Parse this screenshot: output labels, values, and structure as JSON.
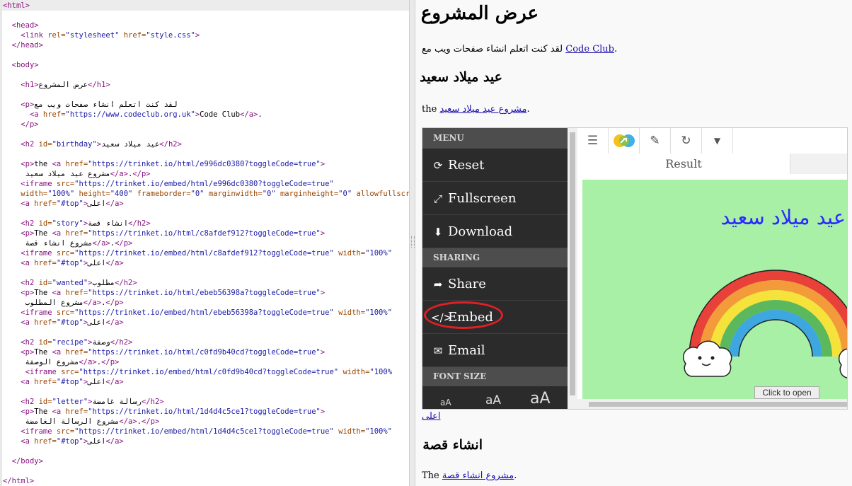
{
  "editor": {
    "lines": [
      {
        "t": [
          [
            "tag",
            "<html>"
          ]
        ]
      },
      {
        "t": []
      },
      {
        "t": [
          [
            "text",
            "  "
          ],
          [
            "tag",
            "<head>"
          ]
        ]
      },
      {
        "t": [
          [
            "text",
            "    "
          ],
          [
            "tag",
            "<link "
          ],
          [
            "attr",
            "rel="
          ],
          [
            "val",
            "\"stylesheet\""
          ],
          [
            "attr",
            " href="
          ],
          [
            "val",
            "\"style.css\""
          ],
          [
            "tag",
            ">"
          ]
        ]
      },
      {
        "t": [
          [
            "text",
            "  "
          ],
          [
            "tag",
            "</head>"
          ]
        ]
      },
      {
        "t": []
      },
      {
        "t": [
          [
            "text",
            "  "
          ],
          [
            "tag",
            "<body>"
          ]
        ]
      },
      {
        "t": []
      },
      {
        "t": [
          [
            "text",
            "    "
          ],
          [
            "tag",
            "<h1>"
          ],
          [
            "text",
            "عرض المشروع"
          ],
          [
            "tag",
            "</h1>"
          ]
        ]
      },
      {
        "t": []
      },
      {
        "t": [
          [
            "text",
            "    "
          ],
          [
            "tag",
            "<p>"
          ],
          [
            "text",
            "لقد كنت اتعلم انشاء صفحات ويب مع"
          ]
        ]
      },
      {
        "t": [
          [
            "text",
            "      "
          ],
          [
            "tag",
            "<a "
          ],
          [
            "attr",
            "href="
          ],
          [
            "val",
            "\"https://www.codeclub.org.uk\""
          ],
          [
            "tag",
            ">"
          ],
          [
            "text",
            "Code Club"
          ],
          [
            "tag",
            "</a>"
          ],
          [
            "text",
            "."
          ]
        ]
      },
      {
        "t": [
          [
            "text",
            "    "
          ],
          [
            "tag",
            "</p>"
          ]
        ]
      },
      {
        "t": []
      },
      {
        "t": [
          [
            "text",
            "    "
          ],
          [
            "tag",
            "<h2 "
          ],
          [
            "attr",
            "id="
          ],
          [
            "val",
            "\"birthday\""
          ],
          [
            "tag",
            ">"
          ],
          [
            "text",
            "عيد ميلاد سعيد"
          ],
          [
            "tag",
            "</h2>"
          ]
        ]
      },
      {
        "t": []
      },
      {
        "t": [
          [
            "text",
            "    "
          ],
          [
            "tag",
            "<p>"
          ],
          [
            "text",
            "the "
          ],
          [
            "tag",
            "<a "
          ],
          [
            "attr",
            "href="
          ],
          [
            "val",
            "\"https://trinket.io/html/e996dc0380?toggleCode=true\""
          ],
          [
            "tag",
            ">"
          ]
        ]
      },
      {
        "t": [
          [
            "text",
            "     مشروع عيد ميلاد سعيد"
          ],
          [
            "tag",
            "</a>"
          ],
          [
            "text",
            "."
          ],
          [
            "tag",
            "</p>"
          ]
        ]
      },
      {
        "t": [
          [
            "text",
            "    "
          ],
          [
            "tag",
            "<iframe "
          ],
          [
            "attr",
            "src="
          ],
          [
            "val",
            "\"https://trinket.io/embed/html/e996dc0380?toggleCode=true\""
          ]
        ]
      },
      {
        "t": [
          [
            "attr",
            "    width="
          ],
          [
            "val",
            "\"100%\""
          ],
          [
            "attr",
            " height="
          ],
          [
            "val",
            "\"400\""
          ],
          [
            "attr",
            " frameborder="
          ],
          [
            "val",
            "\"0\""
          ],
          [
            "attr",
            " marginwidth="
          ],
          [
            "val",
            "\"0\""
          ],
          [
            "attr",
            " marginheight="
          ],
          [
            "val",
            "\"0\""
          ],
          [
            "attr",
            " allowfullscreen"
          ]
        ]
      },
      {
        "t": [
          [
            "text",
            "    "
          ],
          [
            "tag",
            "<a "
          ],
          [
            "attr",
            "href="
          ],
          [
            "val",
            "\"#top\""
          ],
          [
            "tag",
            ">"
          ],
          [
            "text",
            "اعلى"
          ],
          [
            "tag",
            "</a>"
          ]
        ]
      },
      {
        "t": []
      },
      {
        "t": [
          [
            "text",
            "    "
          ],
          [
            "tag",
            "<h2 "
          ],
          [
            "attr",
            "id="
          ],
          [
            "val",
            "\"story\""
          ],
          [
            "tag",
            ">"
          ],
          [
            "text",
            "انشاء قصة"
          ],
          [
            "tag",
            "</h2>"
          ]
        ]
      },
      {
        "t": [
          [
            "text",
            "    "
          ],
          [
            "tag",
            "<p>"
          ],
          [
            "text",
            "The "
          ],
          [
            "tag",
            "<a "
          ],
          [
            "attr",
            "href="
          ],
          [
            "val",
            "\"https://trinket.io/html/c8afdef912?toggleCode=true\""
          ],
          [
            "tag",
            ">"
          ]
        ]
      },
      {
        "t": [
          [
            "text",
            "     مشروع انشاء قصة"
          ],
          [
            "tag",
            "</a>"
          ],
          [
            "text",
            "."
          ],
          [
            "tag",
            "</p>"
          ]
        ]
      },
      {
        "t": [
          [
            "text",
            "    "
          ],
          [
            "tag",
            "<iframe "
          ],
          [
            "attr",
            "src="
          ],
          [
            "val",
            "\"https://trinket.io/embed/html/c8afdef912?toggleCode=true\""
          ],
          [
            "attr",
            " width="
          ],
          [
            "val",
            "\"100%\""
          ]
        ]
      },
      {
        "t": [
          [
            "text",
            "    "
          ],
          [
            "tag",
            "<a "
          ],
          [
            "attr",
            "href="
          ],
          [
            "val",
            "\"#top\""
          ],
          [
            "tag",
            ">"
          ],
          [
            "text",
            "اعلى"
          ],
          [
            "tag",
            "</a>"
          ]
        ]
      },
      {
        "t": []
      },
      {
        "t": [
          [
            "text",
            "    "
          ],
          [
            "tag",
            "<h2 "
          ],
          [
            "attr",
            "id="
          ],
          [
            "val",
            "\"wanted\""
          ],
          [
            "tag",
            ">"
          ],
          [
            "text",
            "مطلوب"
          ],
          [
            "tag",
            "</h2>"
          ]
        ]
      },
      {
        "t": [
          [
            "text",
            "    "
          ],
          [
            "tag",
            "<p>"
          ],
          [
            "text",
            "The "
          ],
          [
            "tag",
            "<a "
          ],
          [
            "attr",
            "href="
          ],
          [
            "val",
            "\"https://trinket.io/html/ebeb56398a?toggleCode=true\""
          ],
          [
            "tag",
            ">"
          ]
        ]
      },
      {
        "t": [
          [
            "text",
            "     مشروع المطلوب"
          ],
          [
            "tag",
            "</a>"
          ],
          [
            "text",
            "."
          ],
          [
            "tag",
            "</p>"
          ]
        ]
      },
      {
        "t": [
          [
            "text",
            "    "
          ],
          [
            "tag",
            "<iframe "
          ],
          [
            "attr",
            "src="
          ],
          [
            "val",
            "\"https://trinket.io/embed/html/ebeb56398a?toggleCode=true\""
          ],
          [
            "attr",
            " width="
          ],
          [
            "val",
            "\"100%\""
          ]
        ]
      },
      {
        "t": [
          [
            "text",
            "    "
          ],
          [
            "tag",
            "<a "
          ],
          [
            "attr",
            "href="
          ],
          [
            "val",
            "\"#top\""
          ],
          [
            "tag",
            ">"
          ],
          [
            "text",
            "اعلى"
          ],
          [
            "tag",
            "</a>"
          ]
        ]
      },
      {
        "t": []
      },
      {
        "t": [
          [
            "text",
            "    "
          ],
          [
            "tag",
            "<h2 "
          ],
          [
            "attr",
            "id="
          ],
          [
            "val",
            "\"recipe\""
          ],
          [
            "tag",
            ">"
          ],
          [
            "text",
            "وصفة"
          ],
          [
            "tag",
            "</h2>"
          ]
        ]
      },
      {
        "t": [
          [
            "text",
            "    "
          ],
          [
            "tag",
            "<p>"
          ],
          [
            "text",
            "The "
          ],
          [
            "tag",
            "<a "
          ],
          [
            "attr",
            "href="
          ],
          [
            "val",
            "\"https://trinket.io/html/c0fd9b40cd?toggleCode=true\""
          ],
          [
            "tag",
            ">"
          ]
        ]
      },
      {
        "t": [
          [
            "text",
            "     مشروع الوصفة"
          ],
          [
            "tag",
            "</a>"
          ],
          [
            "text",
            "."
          ],
          [
            "tag",
            "</p>"
          ]
        ]
      },
      {
        "t": [
          [
            "text",
            "     "
          ],
          [
            "tag",
            "<iframe "
          ],
          [
            "attr",
            "src="
          ],
          [
            "val",
            "\"https://trinket.io/embed/html/c0fd9b40cd?toggleCode=true\""
          ],
          [
            "attr",
            " width="
          ],
          [
            "val",
            "\"100%"
          ]
        ]
      },
      {
        "t": [
          [
            "text",
            "    "
          ],
          [
            "tag",
            "<a "
          ],
          [
            "attr",
            "href="
          ],
          [
            "val",
            "\"#top\""
          ],
          [
            "tag",
            ">"
          ],
          [
            "text",
            "اعلى"
          ],
          [
            "tag",
            "</a>"
          ]
        ]
      },
      {
        "t": []
      },
      {
        "t": [
          [
            "text",
            "    "
          ],
          [
            "tag",
            "<h2 "
          ],
          [
            "attr",
            "id="
          ],
          [
            "val",
            "\"letter\""
          ],
          [
            "tag",
            ">"
          ],
          [
            "text",
            "رسالة غامضة"
          ],
          [
            "tag",
            "</h2>"
          ]
        ]
      },
      {
        "t": [
          [
            "text",
            "    "
          ],
          [
            "tag",
            "<p>"
          ],
          [
            "text",
            "The "
          ],
          [
            "tag",
            "<a "
          ],
          [
            "attr",
            "href="
          ],
          [
            "val",
            "\"https://trinket.io/html/1d4d4c5ce1?toggleCode=true\""
          ],
          [
            "tag",
            ">"
          ]
        ]
      },
      {
        "t": [
          [
            "text",
            "     مشروع الرسالة الغامضة"
          ],
          [
            "tag",
            "</a>"
          ],
          [
            "text",
            "."
          ],
          [
            "tag",
            "</p>"
          ]
        ]
      },
      {
        "t": [
          [
            "text",
            "    "
          ],
          [
            "tag",
            "<iframe "
          ],
          [
            "attr",
            "src="
          ],
          [
            "val",
            "\"https://trinket.io/embed/html/1d4d4c5ce1?toggleCode=true\""
          ],
          [
            "attr",
            " width="
          ],
          [
            "val",
            "\"100%\""
          ]
        ]
      },
      {
        "t": [
          [
            "text",
            "    "
          ],
          [
            "tag",
            "<a "
          ],
          [
            "attr",
            "href="
          ],
          [
            "val",
            "\"#top\""
          ],
          [
            "tag",
            ">"
          ],
          [
            "text",
            "اعلى"
          ],
          [
            "tag",
            "</a>"
          ]
        ]
      },
      {
        "t": []
      },
      {
        "t": [
          [
            "text",
            "  "
          ],
          [
            "tag",
            "</body>"
          ]
        ]
      },
      {
        "t": []
      },
      {
        "t": [
          [
            "tag",
            "</html>"
          ]
        ]
      }
    ]
  },
  "preview": {
    "h1": "عرض المشروع",
    "intro_text": "لقد كنت اتعلم انشاء صفحات ويب مع ",
    "intro_link": "Code Club",
    "intro_end": ".",
    "h2_birthday": "عيد ميلاد سعيد",
    "birthday_prefix": "the ",
    "birthday_link": "مشروع عيد ميلاد سعيد",
    "birthday_end": ".",
    "top_link": "اعلى",
    "h2_story": "انشاء قصة",
    "story_prefix": "The ",
    "story_link": "مشروع انشاء قصة",
    "story_end": "."
  },
  "trinket": {
    "menu_header": "MENU",
    "items": {
      "reset": "Reset",
      "fullscreen": "Fullscreen",
      "download": "Download",
      "share": "Share",
      "embed": "Embed",
      "email": "Email"
    },
    "sharing_header": "SHARING",
    "font_size_header": "FONT SIZE",
    "font_sizes": [
      "aA",
      "aA",
      "aA"
    ],
    "result_tab": "Result",
    "result_title": "عيد ميلاد سعيد",
    "click_to_open": "Click to open",
    "highlight_color": "#e01f26",
    "result_bg": "#a8f0a6"
  }
}
